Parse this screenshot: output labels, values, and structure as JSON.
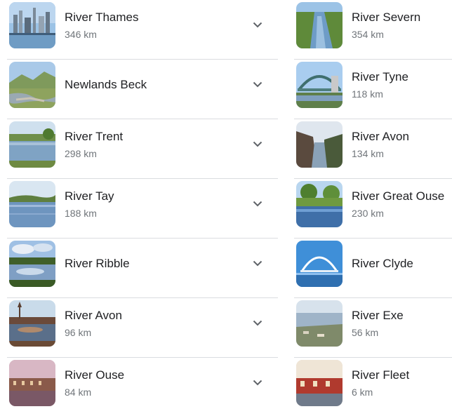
{
  "left_column": [
    {
      "name": "River Thames",
      "length": "346 km",
      "icon": "chevron-down-icon"
    },
    {
      "name": "Newlands Beck",
      "length": "",
      "icon": "chevron-down-icon"
    },
    {
      "name": "River Trent",
      "length": "298 km",
      "icon": "chevron-down-icon"
    },
    {
      "name": "River Tay",
      "length": "188 km",
      "icon": "chevron-down-icon"
    },
    {
      "name": "River Ribble",
      "length": "",
      "icon": "chevron-down-icon"
    },
    {
      "name": "River Avon",
      "length": "96 km",
      "icon": "chevron-down-icon"
    },
    {
      "name": "River Ouse",
      "length": "84 km",
      "icon": "chevron-down-icon"
    }
  ],
  "right_column": [
    {
      "name": "River Severn",
      "length": "354 km"
    },
    {
      "name": "River Tyne",
      "length": "118 km"
    },
    {
      "name": "River Avon",
      "length": "134 km"
    },
    {
      "name": "River Great Ouse",
      "length": "230 km"
    },
    {
      "name": "River Clyde",
      "length": ""
    },
    {
      "name": "River Exe",
      "length": "56 km"
    },
    {
      "name": "River Fleet",
      "length": "6 km"
    }
  ],
  "colors": {
    "text_primary": "#202124",
    "text_secondary": "#70757a",
    "divider": "#dadce0"
  }
}
